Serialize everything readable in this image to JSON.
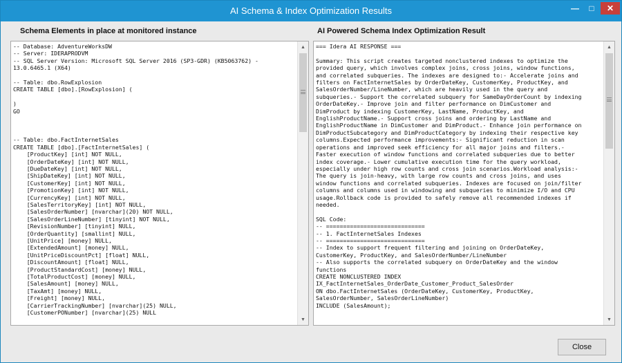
{
  "window": {
    "title": "AI Schema & Index Optimization Results",
    "minimize_glyph": "—",
    "maximize_glyph": "□",
    "close_glyph": "✕"
  },
  "left_panel": {
    "title": "Schema Elements in place at monitored instance",
    "text": "-- Database: AdventureWorksDW\n-- Server: IDERAPRODVM\n-- SQL Server Version: Microsoft SQL Server 2016 (SP3-GDR) (KB5063762) -\n13.0.6465.1 (X64)\n\n-- Table: dbo.RowExplosion\nCREATE TABLE [dbo].[RowExplosion] (\n\n)\nGO\n\n\n\n-- Table: dbo.FactInternetSales\nCREATE TABLE [dbo].[FactInternetSales] (\n    [ProductKey] [int] NOT NULL,\n    [OrderDateKey] [int] NOT NULL,\n    [DueDateKey] [int] NOT NULL,\n    [ShipDateKey] [int] NOT NULL,\n    [CustomerKey] [int] NOT NULL,\n    [PromotionKey] [int] NOT NULL,\n    [CurrencyKey] [int] NOT NULL,\n    [SalesTerritoryKey] [int] NOT NULL,\n    [SalesOrderNumber] [nvarchar](20) NOT NULL,\n    [SalesOrderLineNumber] [tinyint] NOT NULL,\n    [RevisionNumber] [tinyint] NULL,\n    [OrderQuantity] [smallint] NULL,\n    [UnitPrice] [money] NULL,\n    [ExtendedAmount] [money] NULL,\n    [UnitPriceDiscountPct] [float] NULL,\n    [DiscountAmount] [float] NULL,\n    [ProductStandardCost] [money] NULL,\n    [TotalProductCost] [money] NULL,\n    [SalesAmount] [money] NULL,\n    [TaxAmt] [money] NULL,\n    [Freight] [money] NULL,\n    [CarrierTrackingNumber] [nvarchar](25) NULL,\n    [CustomerPONumber] [nvarchar](25) NULL"
  },
  "right_panel": {
    "title": "AI Powered Schema  Index Optimization Result",
    "text": "=== Idera AI RESPONSE ===\n\nSummary: This script creates targeted nonclustered indexes to optimize the\nprovided query, which involves complex joins, cross joins, window functions,\nand correlated subqueries. The indexes are designed to:- Accelerate joins and\nfilters on FactInternetSales by OrderDateKey, CustomerKey, ProductKey, and\nSalesOrderNumber/LineNumber, which are heavily used in the query and\nsubqueries.- Support the correlated subquery for SameDayOrderCount by indexing\nOrderDateKey.- Improve join and filter performance on DimCustomer and\nDimProduct by indexing CustomerKey, LastName, ProductKey, and\nEnglishProductName.- Support cross joins and ordering by LastName and\nEnglishProductName in DimCustomer and DimProduct.- Enhance join performance on\nDimProductSubcategory and DimProductCategory by indexing their respective key\ncolumns.Expected performance improvements:- Significant reduction in scan\noperations and improved seek efficiency for all major joins and filters.-\nFaster execution of window functions and correlated subqueries due to better\nindex coverage.- Lower cumulative execution time for the query workload,\nespecially under high row counts and cross join scenarios.Workload analysis:-\nThe query is join-heavy, with large row counts and cross joins, and uses\nwindow functions and correlated subqueries. Indexes are focused on join/filter\ncolumns and columns used in windowing and subqueries to minimize I/O and CPU\nusage.Rollback code is provided to safely remove all recommended indexes if\nneeded.\n\nSQL Code:\n-- =============================\n-- 1. FactInternetSales Indexes\n-- =============================\n-- Index to support frequent filtering and joining on OrderDateKey,\nCustomerKey, ProductKey, and SalesOrderNumber/LineNumber\n-- Also supports the correlated subquery on OrderDateKey and the window\nfunctions\nCREATE NONCLUSTERED INDEX\nIX_FactInternetSales_OrderDate_Customer_Product_SalesOrder\nON dbo.FactInternetSales (OrderDateKey, CustomerKey, ProductKey,\nSalesOrderNumber, SalesOrderLineNumber)\nINCLUDE (SalesAmount);"
  },
  "footer": {
    "close_label": "Close"
  },
  "colors": {
    "titlebar": "#1f94d2",
    "window_bg": "#eaeaea",
    "close_x_bg": "#c7403a"
  }
}
